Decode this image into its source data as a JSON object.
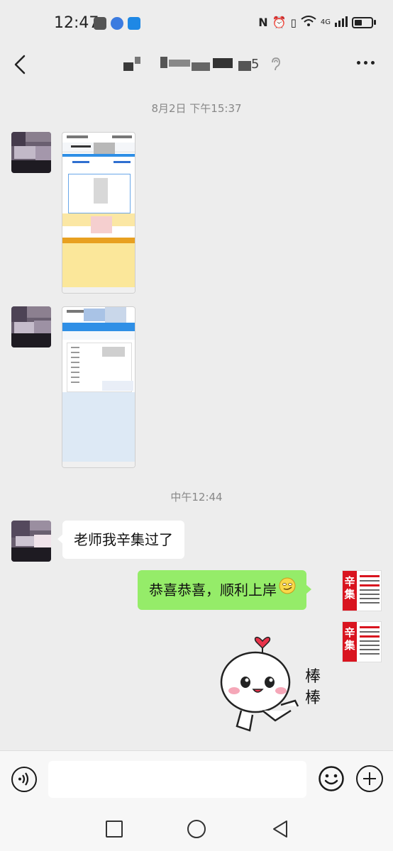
{
  "status_bar": {
    "time": "12:47",
    "network": "4G"
  },
  "header": {
    "title_suffix": "5"
  },
  "messages": {
    "timestamp_1": "8月2日 下午15:37",
    "timestamp_2": "中午12:44",
    "incoming_text": "老师我辛集过了",
    "outgoing_text": "恭喜恭喜，顺利上岸"
  },
  "my_avatar": {
    "logo_text": "辛集"
  },
  "sticker": {
    "text": "棒棒"
  },
  "input_bar": {
    "message_value": ""
  },
  "colors": {
    "outgoing_bubble": "#95ec69",
    "chat_background": "#ededed",
    "accent_red": "#d9141f"
  },
  "icons": {
    "back": "chevron-left-icon",
    "more": "more-dots-icon",
    "voice": "voice-icon",
    "emoji": "emoji-icon",
    "plus": "plus-icon"
  }
}
